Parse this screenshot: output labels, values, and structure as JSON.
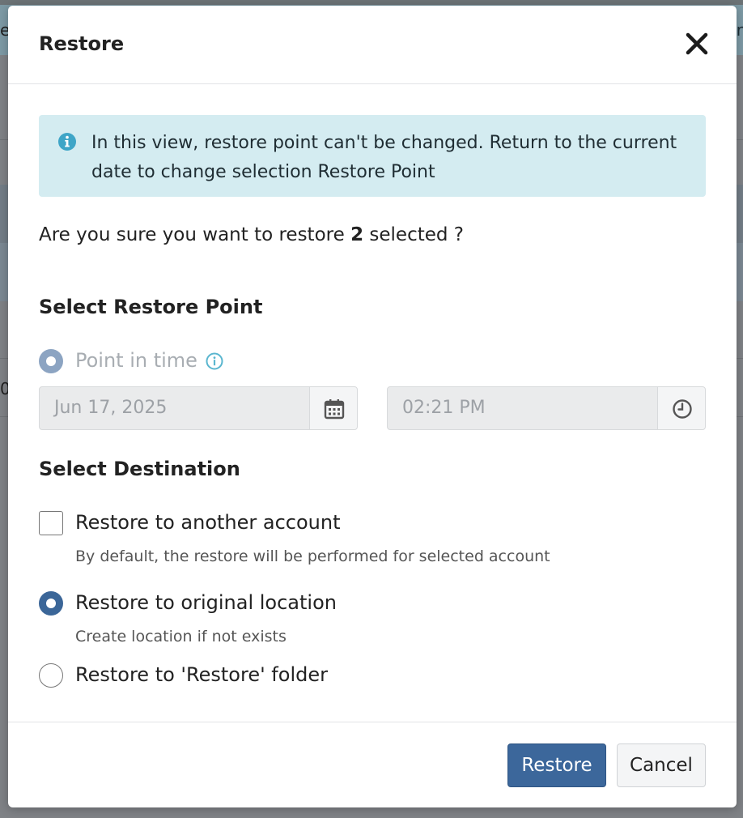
{
  "backdrop": {
    "left_edge_text": "e",
    "right_edge_text": "r",
    "left_edge_text2": "0"
  },
  "modal": {
    "title": "Restore",
    "close_icon": "close-icon",
    "alert": {
      "icon": "info-circle-icon",
      "text": "In this view, restore point can't be changed. Return to the current date to change selection Restore Point",
      "background": "#d4ecf1"
    },
    "confirm": {
      "prefix": "Are you sure you want to restore ",
      "count": "2",
      "suffix": " selected ?"
    },
    "restore_point": {
      "section_title": "Select Restore Point",
      "option_label": "Point in time",
      "option_info_icon": "info-circle-icon",
      "date_value": "Jun 17, 2025",
      "date_icon": "calendar-icon",
      "time_value": "02:21 PM",
      "time_icon": "clock-icon"
    },
    "destination": {
      "section_title": "Select Destination",
      "options": [
        {
          "label": "Restore to another account",
          "help": "By default, the restore will be performed for selected account",
          "control": "checkbox",
          "checked": false
        },
        {
          "label": "Restore to original location",
          "help": "Create location if not exists",
          "control": "radio",
          "checked": true
        },
        {
          "label": "Restore to 'Restore' folder",
          "help": "",
          "control": "radio",
          "checked": false
        }
      ]
    },
    "footer": {
      "primary_label": "Restore",
      "secondary_label": "Cancel",
      "primary_color": "#3c679b"
    }
  }
}
